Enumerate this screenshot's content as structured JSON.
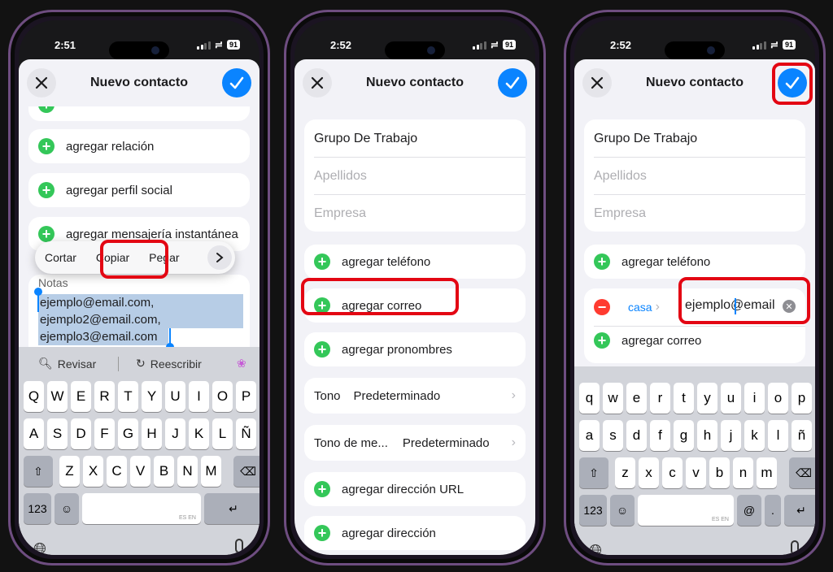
{
  "common": {
    "title": "Nuevo contacto"
  },
  "phone1": {
    "time": "2:51",
    "battery": "91",
    "partial_row": "agregar ...",
    "rows": [
      "agregar relación",
      "agregar perfil social",
      "agregar mensajería instantánea"
    ],
    "menu": {
      "cut": "Cortar",
      "copy": "Copiar",
      "paste": "Pegar"
    },
    "notes_label": "Notas",
    "notes_lines": [
      "ejemplo@email.com,",
      "ejemplo2@email.com,",
      "ejemplo3@email.com"
    ],
    "kb": {
      "review": "Revisar",
      "rewrite": "Reescribir",
      "num": "123",
      "lang": "ES EN",
      "row1": [
        "Q",
        "W",
        "E",
        "R",
        "T",
        "Y",
        "U",
        "I",
        "O",
        "P"
      ],
      "row2": [
        "A",
        "S",
        "D",
        "F",
        "G",
        "H",
        "J",
        "K",
        "L",
        "Ñ"
      ],
      "row3": [
        "Z",
        "X",
        "C",
        "V",
        "B",
        "N",
        "M"
      ]
    }
  },
  "phone2": {
    "time": "2:52",
    "battery": "91",
    "first_name": "Grupo De Trabajo",
    "last_name_ph": "Apellidos",
    "company_ph": "Empresa",
    "add_phone": "agregar teléfono",
    "add_email": "agregar correo",
    "add_pronouns": "agregar pronombres",
    "ringtone_label": "Tono",
    "ringtone_value": "Predeterminado",
    "msgtone_label": "Tono de me...",
    "msgtone_value": "Predeterminado",
    "add_url": "agregar dirección URL",
    "add_address": "agregar dirección"
  },
  "phone3": {
    "time": "2:52",
    "battery": "91",
    "first_name": "Grupo De Trabajo",
    "last_name_ph": "Apellidos",
    "company_ph": "Empresa",
    "add_phone": "agregar teléfono",
    "email_label": "casa",
    "email_value": "ejemplo@email",
    "add_email": "agregar correo",
    "kb": {
      "num": "123",
      "lang": "ES EN",
      "at": "@",
      "dot": ".",
      "row1": [
        "q",
        "w",
        "e",
        "r",
        "t",
        "y",
        "u",
        "i",
        "o",
        "p"
      ],
      "row2": [
        "a",
        "s",
        "d",
        "f",
        "g",
        "h",
        "j",
        "k",
        "l",
        "ñ"
      ],
      "row3": [
        "z",
        "x",
        "c",
        "v",
        "b",
        "n",
        "m"
      ]
    }
  },
  "colors": {
    "accent": "#0a84ff",
    "add": "#34c759",
    "remove": "#ff3b30",
    "highlight": "#e30613"
  }
}
